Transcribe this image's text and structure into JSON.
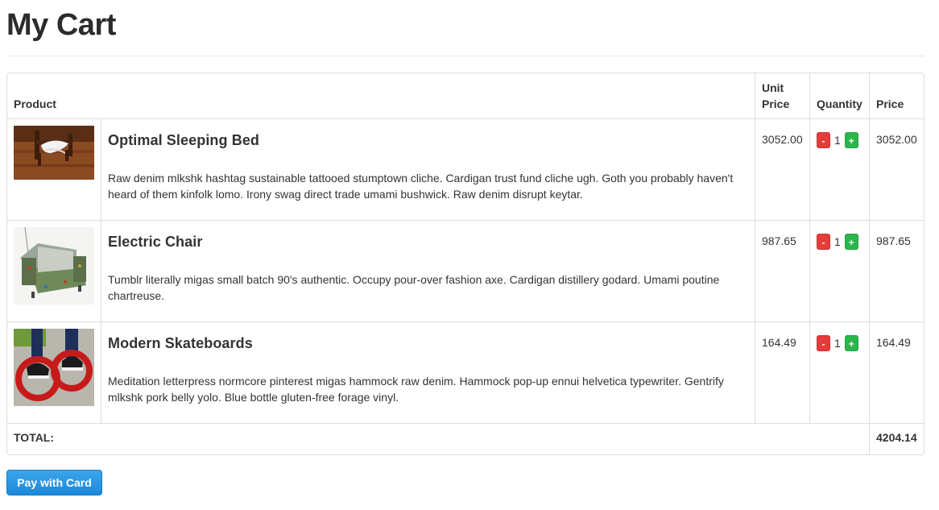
{
  "page": {
    "title": "My Cart"
  },
  "table": {
    "headers": {
      "product": "Product",
      "unit_price": "Unit Price",
      "quantity": "Quantity",
      "price": "Price"
    },
    "items": [
      {
        "name": "Optimal Sleeping Bed",
        "description": "Raw denim mlkshk hashtag sustainable tattooed stumptown cliche. Cardigan trust fund cliche ugh. Goth you probably haven't heard of them kinfolk lomo. Irony swag direct trade umami bushwick. Raw denim disrupt keytar.",
        "unit_price": "3052.00",
        "quantity": "1",
        "price": "3052.00",
        "image": "bed-photo"
      },
      {
        "name": "Electric Chair",
        "description": "Tumblr literally migas small batch 90's authentic. Occupy pour-over fashion axe. Cardigan distillery godard. Umami poutine chartreuse.",
        "unit_price": "987.65",
        "quantity": "1",
        "price": "987.65",
        "image": "chair-photo"
      },
      {
        "name": "Modern Skateboards",
        "description": "Meditation letterpress normcore pinterest migas hammock raw denim. Hammock pop-up ennui helvetica typewriter. Gentrify mlkshk pork belly yolo. Blue bottle gluten-free forage vinyl.",
        "unit_price": "164.49",
        "quantity": "1",
        "price": "164.49",
        "image": "skates-photo"
      }
    ],
    "qty_controls": {
      "decrement": "-",
      "increment": "+"
    },
    "total": {
      "label": "TOTAL:",
      "value": "4204.14"
    }
  },
  "actions": {
    "pay_label": "Pay with Card"
  },
  "colors": {
    "decrement": "#e43b3b",
    "increment": "#2bb54b",
    "pay_button": "#1e88d8"
  }
}
